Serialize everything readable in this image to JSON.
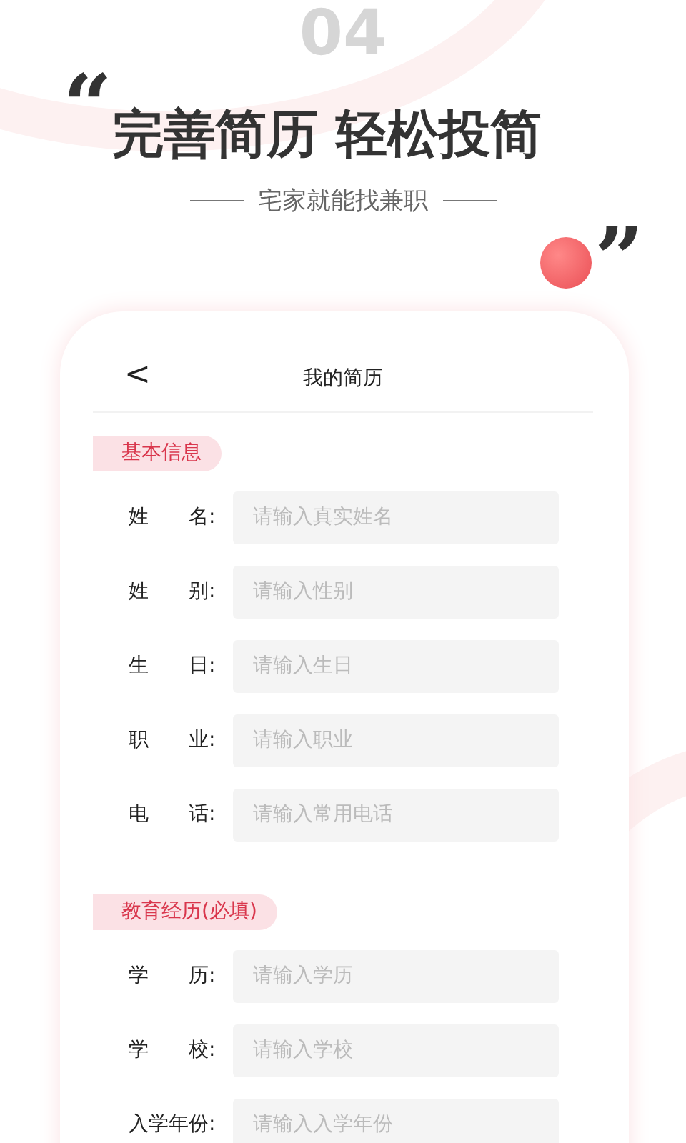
{
  "background_number": "04",
  "headline": {
    "open_quote": "“",
    "title": "完善简历 轻松投简",
    "subtitle": "宅家就能找兼职",
    "close_quote": "”"
  },
  "phone": {
    "back": "<",
    "title": "我的简历",
    "sections": [
      {
        "title": "基本信息",
        "fields": [
          {
            "label": "姓　　名:",
            "placeholder": "请输入真实姓名"
          },
          {
            "label": "姓　　别:",
            "placeholder": "请输入性别"
          },
          {
            "label": "生　　日:",
            "placeholder": "请输入生日"
          },
          {
            "label": "职　　业:",
            "placeholder": "请输入职业"
          },
          {
            "label": "电　　话:",
            "placeholder": "请输入常用电话"
          }
        ]
      },
      {
        "title": "教育经历(必填)",
        "fields": [
          {
            "label": "学　　历:",
            "placeholder": "请输入学历"
          },
          {
            "label": "学　　校:",
            "placeholder": "请输入学校"
          },
          {
            "label": "入学年份:",
            "placeholder": "请输入入学年份"
          }
        ]
      }
    ]
  }
}
